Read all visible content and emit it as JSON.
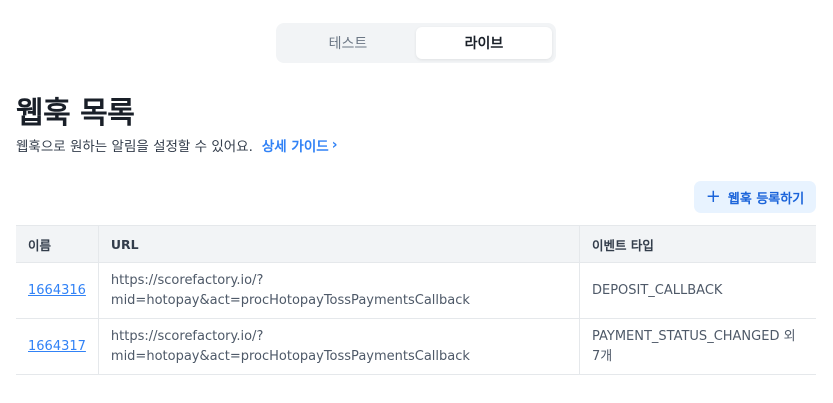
{
  "env_tabs": [
    {
      "label": "테스트",
      "active": false
    },
    {
      "label": "라이브",
      "active": true
    }
  ],
  "page": {
    "title": "웹훅 목록",
    "description": "웹훅으로 원하는 알림을 설정할 수 있어요.",
    "guide_link": "상세 가이드"
  },
  "add_button": {
    "label": "웹훅 등록하기"
  },
  "table": {
    "headers": [
      "이름",
      "URL",
      "이벤트 타입"
    ],
    "rows": [
      {
        "id": "1664316",
        "url_line1": "https://scorefactory.io/?",
        "url_line2": "mid=hotopay&act=procHotopayTossPaymentsCallback",
        "event_line1": "DEPOSIT_CALLBACK",
        "event_line2": ""
      },
      {
        "id": "1664317",
        "url_line1": "https://scorefactory.io/?",
        "url_line2": "mid=hotopay&act=procHotopayTossPaymentsCallback",
        "event_line1": "PAYMENT_STATUS_CHANGED 외",
        "event_line2": "7개"
      }
    ]
  },
  "colors": {
    "accent": "#3182f6",
    "title": "#191f28",
    "header_bg": "#f2f4f6",
    "button_bg": "#e8f3ff"
  }
}
